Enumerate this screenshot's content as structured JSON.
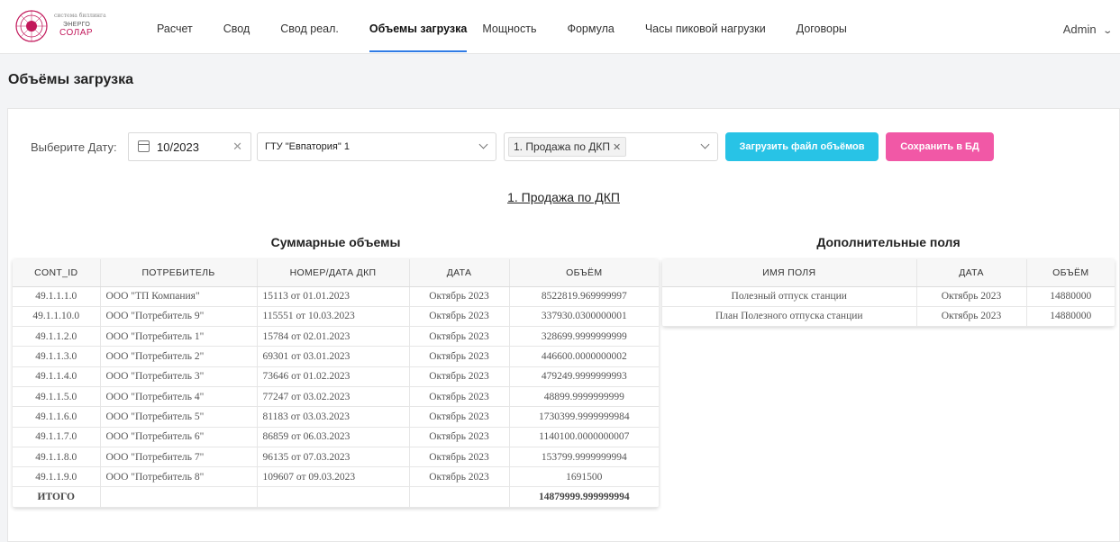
{
  "logo": {
    "line1": "система биллинга",
    "line2": "ЭНЕРГО",
    "line3": "СОЛАР"
  },
  "nav": {
    "items": [
      "Расчет",
      "Свод",
      "Свод реал.",
      "Объемы загрузка",
      "Мощность",
      "Формула",
      "Часы пиковой нагрузки",
      "Договоры"
    ],
    "active": "Объемы загрузка",
    "user": "Admin"
  },
  "page": {
    "title": "Объёмы загрузка"
  },
  "filters": {
    "date_label": "Выберите Дату:",
    "date_value": "10/2023",
    "gtu_value": "ГТУ \"Евпатория\" 1",
    "type_tag": "1. Продажа по ДКП",
    "upload_label": "Загрузить файл объёмов",
    "save_label": "Сохранить в БД"
  },
  "section_title": "1. Продажа по ДКП",
  "summary": {
    "title": "Суммарные объемы",
    "columns": [
      "CONT_ID",
      "ПОТРЕБИТЕЛЬ",
      "НОМЕР/ДАТА ДКП",
      "ДАТА",
      "ОБЪЁМ"
    ],
    "rows": [
      [
        "49.1.1.1.0",
        "ООО \"ТП Компания\"",
        "15113 от 01.01.2023",
        "Октябрь 2023",
        "8522819.969999997"
      ],
      [
        "49.1.1.10.0",
        "ООО \"Потребитель 9\"",
        "115551 от 10.03.2023",
        "Октябрь 2023",
        "337930.0300000001"
      ],
      [
        "49.1.1.2.0",
        "ООО \"Потребитель 1\"",
        "15784 от 02.01.2023",
        "Октябрь 2023",
        "328699.9999999999"
      ],
      [
        "49.1.1.3.0",
        "ООО \"Потребитель 2\"",
        "69301 от 03.01.2023",
        "Октябрь 2023",
        "446600.0000000002"
      ],
      [
        "49.1.1.4.0",
        "ООО \"Потребитель 3\"",
        "73646 от 01.02.2023",
        "Октябрь 2023",
        "479249.9999999993"
      ],
      [
        "49.1.1.5.0",
        "ООО \"Потребитель 4\"",
        "77247 от 03.02.2023",
        "Октябрь 2023",
        "48899.9999999999"
      ],
      [
        "49.1.1.6.0",
        "ООО \"Потребитель 5\"",
        "81183 от 03.03.2023",
        "Октябрь 2023",
        "1730399.9999999984"
      ],
      [
        "49.1.1.7.0",
        "ООО \"Потребитель 6\"",
        "86859 от 06.03.2023",
        "Октябрь 2023",
        "1140100.0000000007"
      ],
      [
        "49.1.1.8.0",
        "ООО \"Потребитель 7\"",
        "96135 от 07.03.2023",
        "Октябрь 2023",
        "153799.9999999994"
      ],
      [
        "49.1.1.9.0",
        "ООО \"Потребитель 8\"",
        "109607 от 09.03.2023",
        "Октябрь 2023",
        "1691500"
      ]
    ],
    "total_label": "ИТОГО",
    "total_value": "14879999.999999994"
  },
  "extra": {
    "title": "Дополнительные поля",
    "columns": [
      "ИМЯ ПОЛЯ",
      "ДАТА",
      "ОБЪЁМ"
    ],
    "rows": [
      [
        "Полезный отпуск станции",
        "Октябрь 2023",
        "14880000"
      ],
      [
        "План Полезного отпуска станции",
        "Октябрь 2023",
        "14880000"
      ]
    ]
  }
}
